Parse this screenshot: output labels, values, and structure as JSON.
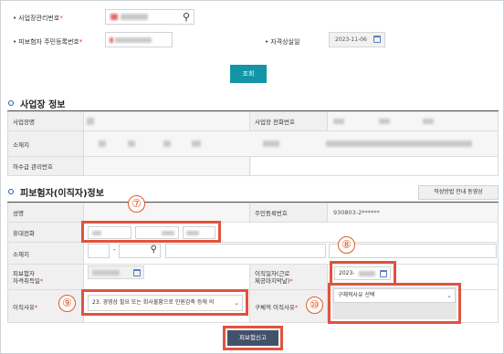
{
  "search": {
    "workplace_no_label": "사업장관리번호",
    "resident_no_label": "피보험자 주민등록번호",
    "loss_date_label": "자격상실일",
    "loss_date_value": "2023-11-06",
    "search_button": "조회"
  },
  "workplace": {
    "section_title": "사업장 정보",
    "name_label": "사업장명",
    "phone_label": "사업장 전화번호",
    "address_label": "소재지",
    "sub_no_label": "하수급 관리번호"
  },
  "insured": {
    "section_title": "피보험자(이직자)정보",
    "guide_button": "작성방법 안내 동영상",
    "name_label": "성명",
    "resident_label": "주민등록번호",
    "resident_value": "930803-2******",
    "mobile_label": "휴대전화",
    "address_label": "소재지",
    "address_sep": "-",
    "acquire_label_1": "피보험자",
    "acquire_label_2": "자격취득일",
    "leave_date_label_1": "이직일자(근로",
    "leave_date_label_2": "제공마지막날)",
    "leave_date_value": "2023-",
    "reason_label": "이직사유",
    "reason_value": "23. 경영상 필요 또는 회사불황으로 인원감축 등에 의",
    "detail_reason_label": "구체적 이직사유",
    "detail_reason_value": "구체적사유 선택",
    "submit_button": "피보험신고"
  },
  "annotations": {
    "marker_7": "⑦",
    "marker_8": "⑧",
    "marker_9": "⑨",
    "marker_10": "⑩"
  },
  "colors": {
    "accent": "#1395a6",
    "highlight": "#e0533d",
    "section_bullet": "#1a5dab",
    "submit": "#43516a"
  }
}
